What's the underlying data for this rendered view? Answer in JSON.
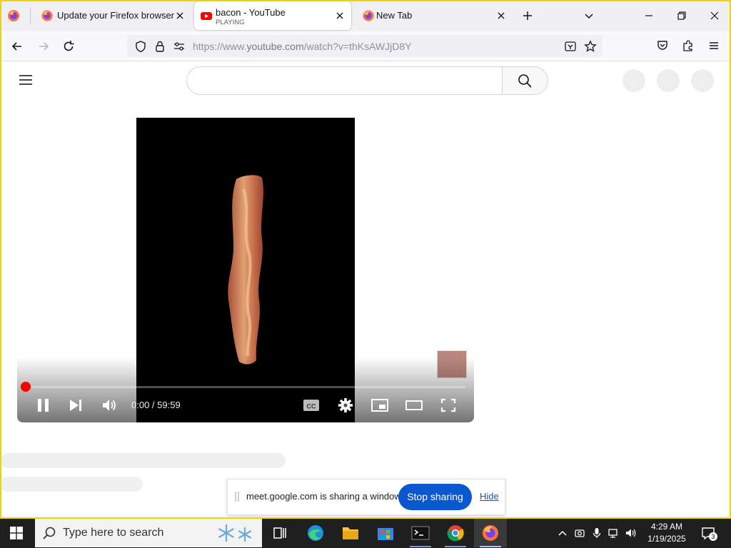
{
  "browser": {
    "tabs": [
      {
        "title": "Update your Firefox browser",
        "icon": "firefox-icon",
        "active": false
      },
      {
        "title": "bacon - YouTube",
        "subtitle": "PLAYING",
        "icon": "youtube-icon",
        "active": true
      },
      {
        "title": "New Tab",
        "icon": "firefox-icon",
        "active": false
      }
    ],
    "url": {
      "prefix": "https://www.",
      "host": "youtube.com",
      "path": "/watch?v=thKsAWJjD8Y"
    }
  },
  "youtube": {
    "search_placeholder": "",
    "player": {
      "time": "0:00 / 59:59",
      "progress": 0.0
    }
  },
  "share_notice": {
    "message": "meet.google.com is sharing a window.",
    "stop_label": "Stop sharing",
    "hide_label": "Hide"
  },
  "taskbar": {
    "search_placeholder": "Type here to search",
    "apps": [
      "task-view",
      "edge",
      "file-explorer",
      "microsoft-store",
      "terminal",
      "chrome",
      "firefox"
    ],
    "clock_time": "4:29 AM",
    "clock_date": "1/19/2025",
    "notification_count": "3"
  },
  "colors": {
    "share_border": "#f2d200",
    "stop_button": "#0b57d0",
    "progress_red": "#ff0000",
    "taskbar_bg": "#1f1f1f"
  }
}
